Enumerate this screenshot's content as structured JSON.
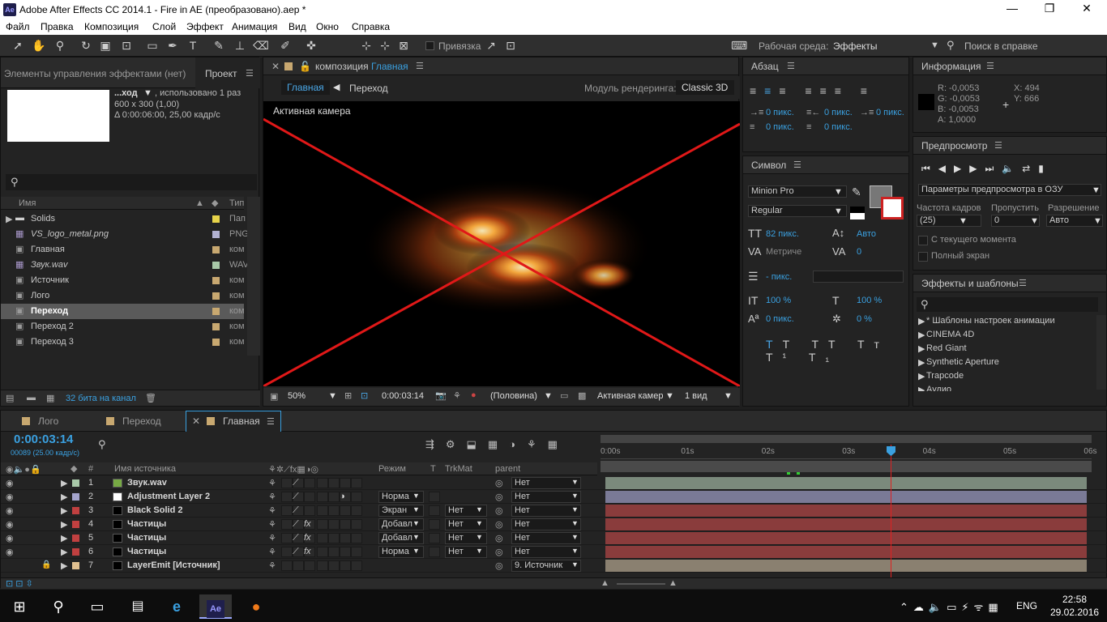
{
  "window": {
    "title": "Adobe After Effects CC 2014.1 - Fire in AE (преобразовано).aep *",
    "app_icon": "Ae",
    "min": "—",
    "max": "❐",
    "close": "✕"
  },
  "menu": [
    "Файл",
    "Правка",
    "Композиция",
    "Слой",
    "Эффект",
    "Анимация",
    "Вид",
    "Окно",
    "Справка"
  ],
  "toolbar": {
    "snap_label": "Привязка",
    "workspace_label": "Рабочая среда:",
    "workspace_value": "Эффекты",
    "help_placeholder": "Поиск в справке"
  },
  "project": {
    "tab_effects": "Элементы управления эффектами (нет)",
    "tab_project": "Проект",
    "comp_name": "...ход",
    "used": ", использовано 1 раз",
    "size": "600 x 300 (1,00)",
    "duration": "Δ 0:00:06:00, 25,00 кадр/с",
    "col_name": "Имя",
    "col_type": "Тип",
    "items": [
      {
        "name": "Solids",
        "type": "Пап",
        "color": "#e8d44a",
        "kind": "folder"
      },
      {
        "name": "VS_logo_metal.png",
        "type": "PNG",
        "color": "#b0b0d0",
        "kind": "img",
        "italic": true
      },
      {
        "name": "Главная",
        "type": "ком",
        "color": "#c8a870",
        "kind": "comp"
      },
      {
        "name": "Звук.wav",
        "type": "WAV",
        "color": "#a8c8a8",
        "kind": "img",
        "italic": true
      },
      {
        "name": "Источник",
        "type": "ком",
        "color": "#c8a870",
        "kind": "comp"
      },
      {
        "name": "Лого",
        "type": "ком",
        "color": "#c8a870",
        "kind": "comp"
      },
      {
        "name": "Переход",
        "type": "ком",
        "color": "#c8a870",
        "kind": "comp",
        "selected": true
      },
      {
        "name": "Переход 2",
        "type": "ком",
        "color": "#c8a870",
        "kind": "comp"
      },
      {
        "name": "Переход 3",
        "type": "ком",
        "color": "#c8a870",
        "kind": "comp"
      }
    ],
    "bits": "32 бита на канал"
  },
  "comp": {
    "tab_prefix": "композиция",
    "tab_name": "Главная",
    "crumb1": "Главная",
    "crumb2": "Переход",
    "renderer_label": "Модуль рендеринга:",
    "renderer": "Classic 3D",
    "camera": "Активная камера",
    "zoom": "50%",
    "timecode": "0:00:03:14",
    "resolution": "(Половина)",
    "view_camera": "Активная камер",
    "views": "1 вид"
  },
  "paragraph": {
    "tab": "Абзац",
    "v1": "0 пикс.",
    "v2": "0 пикс.",
    "v3": "0 пикс.",
    "v4": "0 пикс.",
    "v5": "0 пикс."
  },
  "character": {
    "tab": "Символ",
    "font": "Minion Pro",
    "style": "Regular",
    "size": "82 пикс.",
    "leading": "Авто",
    "kerning": "Метриче",
    "tracking": "0",
    "stroke": "- пикс.",
    "vscale": "100 %",
    "hscale": "100 %",
    "baseline": "0 пикс.",
    "tsume": "0 %"
  },
  "info": {
    "tab": "Информация",
    "r": "R:  -0,0053",
    "g": "G:  -0,0053",
    "b": "B:  -0,0053",
    "a": "A:  1,0000",
    "x": "X:  494",
    "y": "Y:  666"
  },
  "preview": {
    "tab": "Предпросмотр",
    "ram": "Параметры предпросмотра в ОЗУ",
    "fps_label": "Частота кадров",
    "skip_label": "Пропустить",
    "res_label": "Разрешение",
    "fps": "(25)",
    "skip": "0",
    "res": "Авто",
    "from_current": "С текущего момента",
    "fullscreen": "Полный экран"
  },
  "effects": {
    "tab": "Эффекты и шаблоны",
    "items": [
      "* Шаблоны настроек анимации",
      "CINEMA 4D",
      "Red Giant",
      "Synthetic Aperture",
      "Trapcode",
      "Аудио"
    ]
  },
  "timeline": {
    "tabs": [
      "Лого",
      "Переход",
      "Главная"
    ],
    "timecode": "0:00:03:14",
    "frames": "00089 (25.00 кадр/с)",
    "col_num": "#",
    "col_source": "Имя источника",
    "col_mode": "Режим",
    "col_t": "T",
    "col_trk": "TrkMat",
    "col_parent": "parent",
    "ruler": [
      "0:00s",
      "01s",
      "02s",
      "03s",
      "04s",
      "05s",
      "06s"
    ],
    "layers": [
      {
        "num": "1",
        "name": "Звук.wav",
        "color": "#a8c8a8",
        "mode": "",
        "trk": "",
        "parent": "Нет",
        "bar": "#7b8a7c"
      },
      {
        "num": "2",
        "name": "Adjustment Layer 2",
        "color": "#a4a4cc",
        "mode": "Норма",
        "trk": "",
        "parent": "Нет",
        "bar": "#7a7a96"
      },
      {
        "num": "3",
        "name": "Black Solid 2",
        "color": "#c04040",
        "mode": "Экран",
        "trk": "Нет",
        "parent": "Нет",
        "bar": "#8a3c3c"
      },
      {
        "num": "4",
        "name": "Частицы",
        "color": "#c04040",
        "mode": "Добавл",
        "trk": "Нет",
        "parent": "Нет",
        "bar": "#8a3c3c"
      },
      {
        "num": "5",
        "name": "Частицы",
        "color": "#c04040",
        "mode": "Добавл",
        "trk": "Нет",
        "parent": "Нет",
        "bar": "#8a3c3c"
      },
      {
        "num": "6",
        "name": "Частицы",
        "color": "#c04040",
        "mode": "Норма",
        "trk": "Нет",
        "parent": "Нет",
        "bar": "#8a3c3c"
      },
      {
        "num": "7",
        "name": "LayerEmit [Источник]",
        "color": "#e0c090",
        "mode": "",
        "trk": "",
        "parent": "9. Источник",
        "bar": "#8a8070"
      }
    ]
  },
  "taskbar": {
    "lang": "ENG",
    "time": "22:58",
    "date": "29.02.2016"
  }
}
